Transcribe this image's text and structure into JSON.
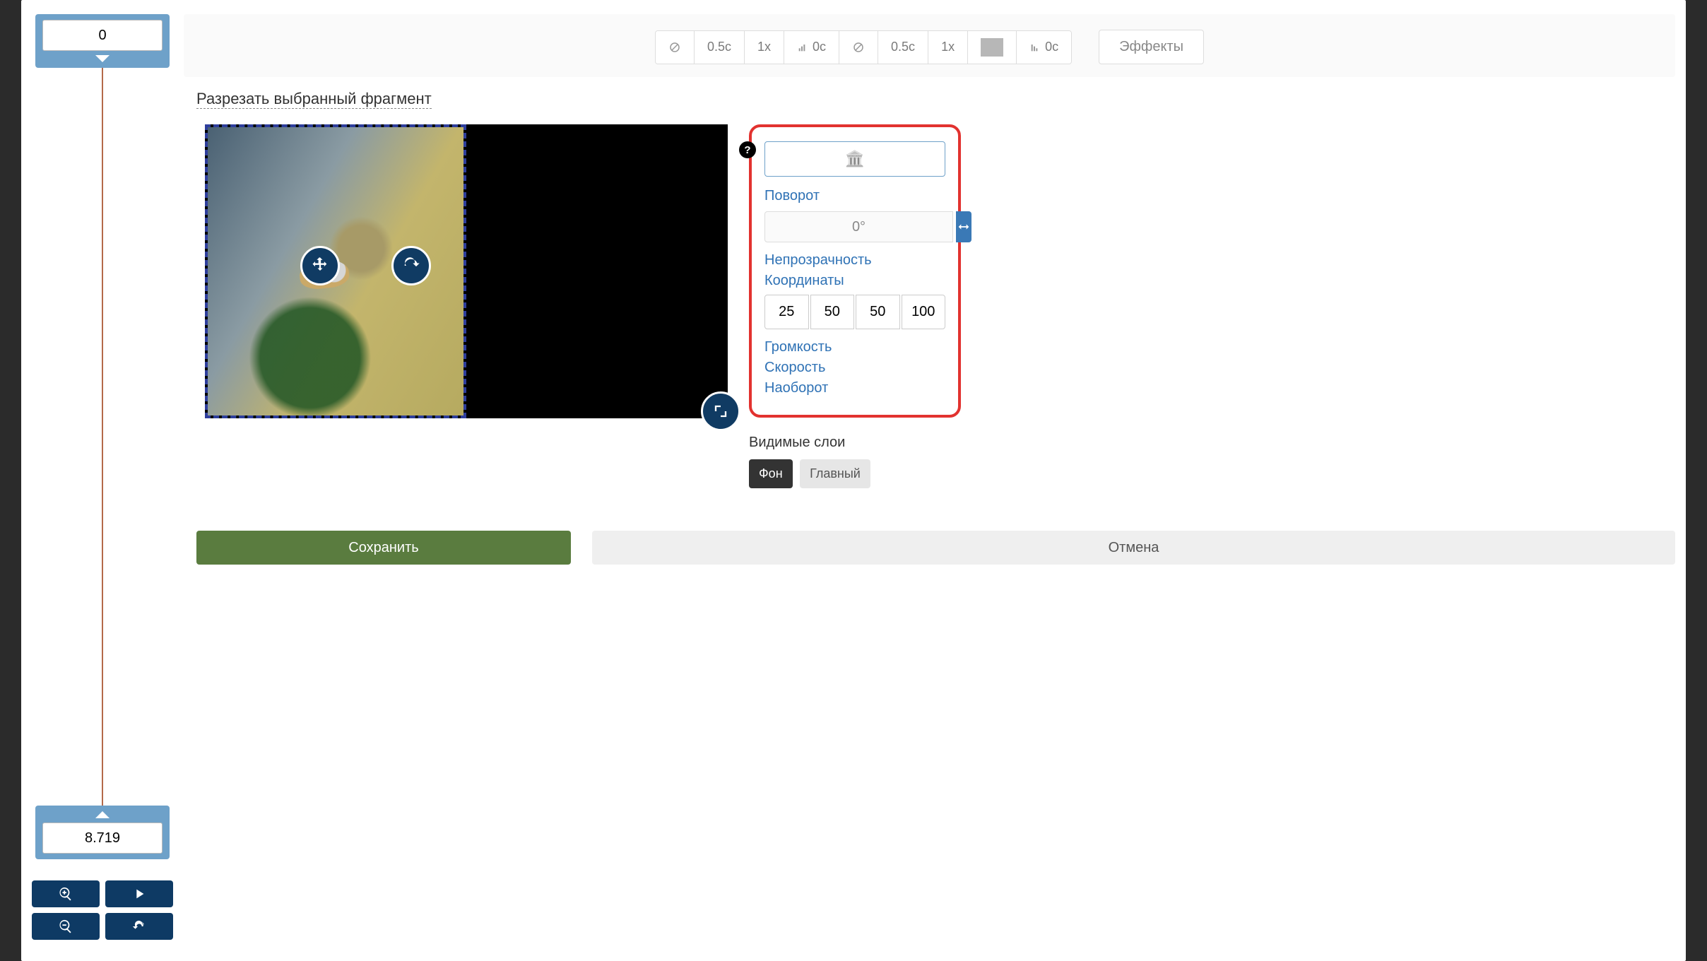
{
  "timeline": {
    "start": "0",
    "end": "8.719"
  },
  "toolbar": {
    "seg1_ease": "0.5с",
    "seg1_speed": "1x",
    "seg1_bars": "0с",
    "seg2_ease": "0.5с",
    "seg2_speed": "1x",
    "seg2_bars": "0с",
    "effects_label": "Эффекты"
  },
  "cut_label": "Разрезать выбранный фрагмент",
  "props": {
    "rotation_label": "Поворот",
    "rotation_value": "0°",
    "opacity_label": "Непрозрачность",
    "coords_label": "Координаты",
    "coords": [
      "25",
      "50",
      "50",
      "100"
    ],
    "volume_label": "Громкость",
    "speed_label": "Скорость",
    "reverse_label": "Наоборот"
  },
  "layers": {
    "title": "Видимые слои",
    "bg_label": "Фон",
    "main_label": "Главный"
  },
  "actions": {
    "save": "Сохранить",
    "cancel": "Отмена"
  }
}
